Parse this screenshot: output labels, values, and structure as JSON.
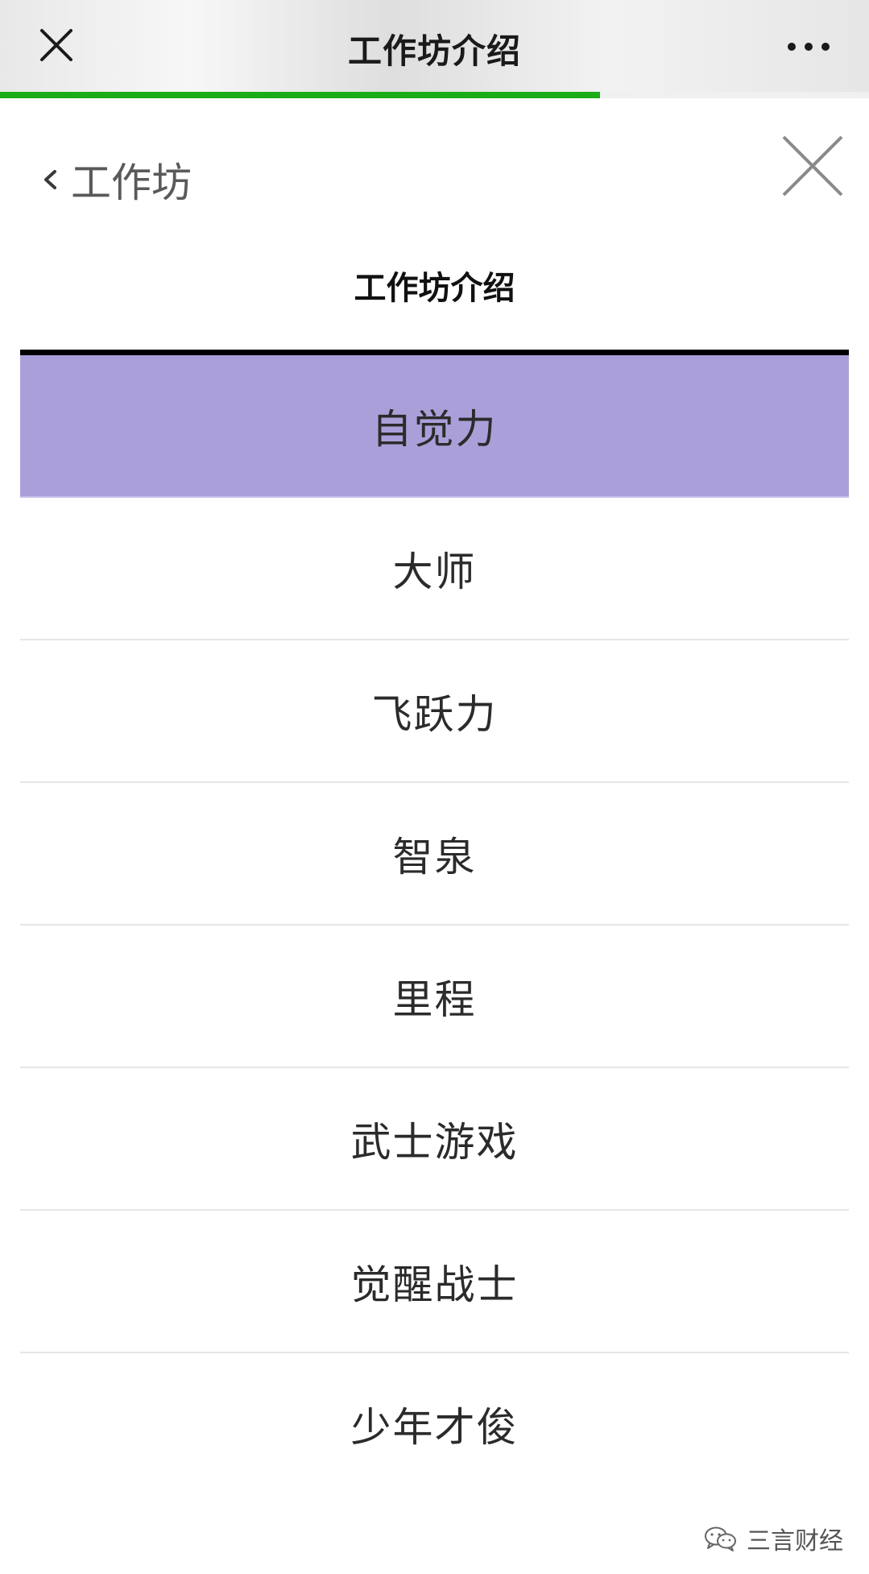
{
  "header": {
    "title": "工作坊介绍",
    "close_icon": "close-icon",
    "more_icon": "more-dots-icon",
    "load_progress_percent": 69,
    "progress_color": "#1aad19"
  },
  "nav": {
    "back_label": "工作坊",
    "back_icon": "chevron-left-icon",
    "panel_close_icon": "close-icon"
  },
  "section": {
    "title": "工作坊介绍"
  },
  "list": {
    "active_color": "#ab9fd9",
    "items": [
      {
        "label": "自觉力",
        "active": true
      },
      {
        "label": "大师",
        "active": false
      },
      {
        "label": "飞跃力",
        "active": false
      },
      {
        "label": "智泉",
        "active": false
      },
      {
        "label": "里程",
        "active": false
      },
      {
        "label": "武士游戏",
        "active": false
      },
      {
        "label": "觉醒战士",
        "active": false
      },
      {
        "label": "少年才俊",
        "active": false
      }
    ]
  },
  "watermark": {
    "text": "三言财经",
    "icon": "wechat-icon"
  }
}
